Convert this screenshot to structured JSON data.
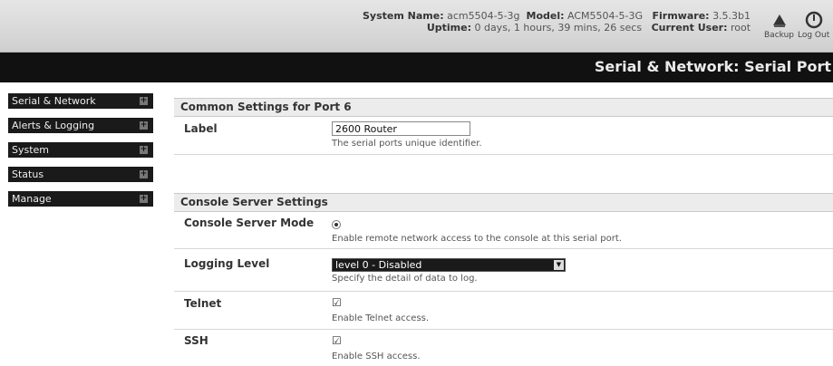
{
  "header": {
    "system_name_label": "System Name:",
    "system_name": "acm5504-5-3g",
    "model_label": "Model:",
    "model": "ACM5504-5-3G",
    "firmware_label": "Firmware:",
    "firmware": "3.5.3b1",
    "uptime_label": "Uptime:",
    "uptime": "0 days, 1 hours, 39 mins, 26 secs",
    "current_user_label": "Current User:",
    "current_user": "root",
    "backup_label": "Backup",
    "logout_label": "Log Out",
    "page_title": "Serial & Network: Serial Port"
  },
  "sidebar": {
    "items": [
      {
        "label": "Serial & Network"
      },
      {
        "label": "Alerts & Logging"
      },
      {
        "label": "System"
      },
      {
        "label": "Status"
      },
      {
        "label": "Manage"
      }
    ],
    "expand_glyph": "+"
  },
  "common": {
    "heading": "Common Settings for Port 6",
    "label_title": "Label",
    "label_value": "2600 Router",
    "label_hint": "The serial ports unique identifier."
  },
  "console": {
    "heading": "Console Server Settings",
    "mode_title": "Console Server Mode",
    "mode_hint": "Enable remote network access to the console at this serial port.",
    "logging_title": "Logging Level",
    "logging_value": "level 0 - Disabled",
    "logging_hint": "Specify the detail of data to log.",
    "telnet_title": "Telnet",
    "telnet_hint": "Enable Telnet access.",
    "ssh_title": "SSH",
    "ssh_hint": "Enable SSH access."
  },
  "icons": {
    "backup": "backup-icon",
    "logout": "power-icon",
    "sidebar_expand": "plus-icon",
    "checkbox_checked": "☑"
  }
}
